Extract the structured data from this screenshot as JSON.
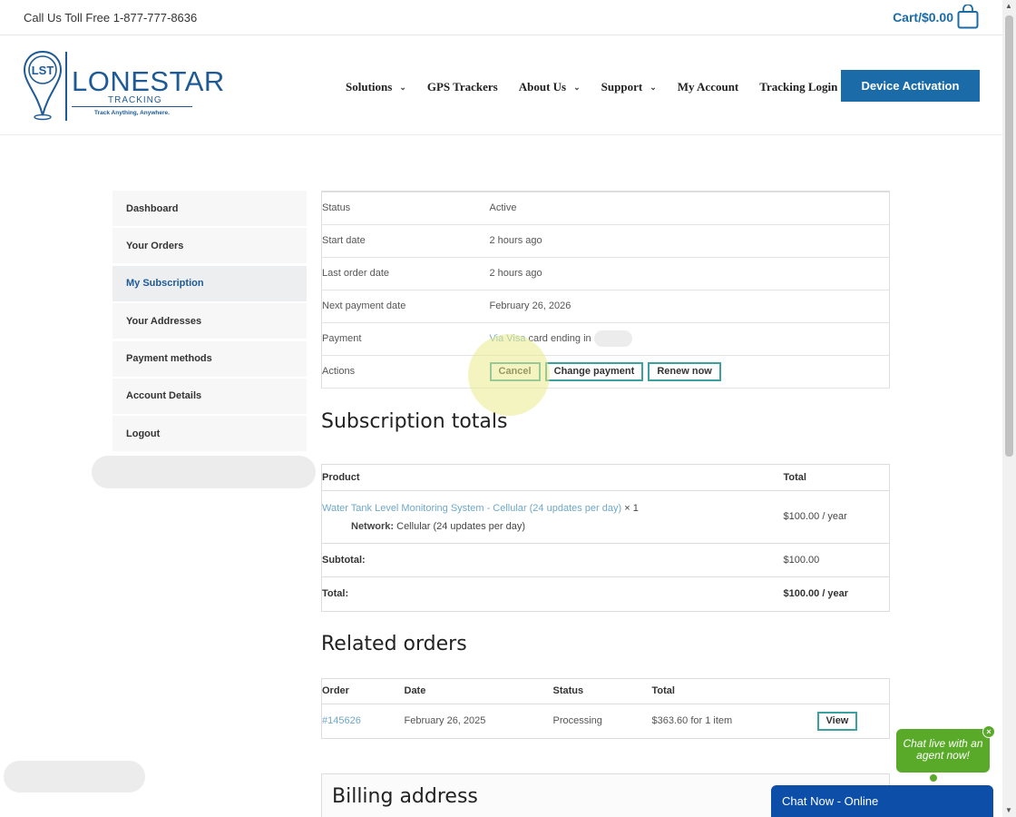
{
  "topbar": {
    "phone": "Call Us Toll Free 1-877-777-8636",
    "cart": "Cart/$0.00"
  },
  "logo": {
    "initials": "LST",
    "name": "LONESTAR",
    "sub": "TRACKING",
    "tagline": "Track Anything, Anywhere."
  },
  "nav": {
    "items": [
      {
        "label": "Solutions",
        "has_menu": true
      },
      {
        "label": "GPS Trackers",
        "has_menu": false
      },
      {
        "label": "About Us",
        "has_menu": true
      },
      {
        "label": "Support",
        "has_menu": true
      },
      {
        "label": "My Account",
        "has_menu": false
      },
      {
        "label": "Tracking Login",
        "has_menu": false
      }
    ],
    "cta": "Device Activation"
  },
  "sidebar": {
    "items": [
      {
        "label": "Dashboard"
      },
      {
        "label": "Your Orders"
      },
      {
        "label": "My Subscription"
      },
      {
        "label": "Your Addresses"
      },
      {
        "label": "Payment methods"
      },
      {
        "label": "Account Details"
      },
      {
        "label": "Logout"
      }
    ],
    "active_index": 2
  },
  "subscription": {
    "status_label": "Status",
    "status_value": "Active",
    "start_label": "Start date",
    "start_value": "2 hours ago",
    "last_order_label": "Last order date",
    "last_order_value": "2 hours ago",
    "next_payment_label": "Next payment date",
    "next_payment_value": "February 26, 2026",
    "payment_label": "Payment",
    "payment_link": "Via Visa",
    "payment_rest": "card ending in",
    "actions_label": "Actions",
    "cancel": "Cancel",
    "change_payment": "Change payment",
    "renew_now": "Renew now"
  },
  "totals": {
    "heading": "Subscription totals",
    "col_product": "Product",
    "col_total": "Total",
    "product_name": "Water Tank Level Monitoring System - Cellular (24 updates per day)",
    "product_qty": "× 1",
    "meta_key": "Network:",
    "meta_value": "Cellular (24 updates per day)",
    "product_total": "$100.00 / year",
    "subtotal_label": "Subtotal:",
    "subtotal_value": "$100.00",
    "total_label": "Total:",
    "total_value": "$100.00 / year"
  },
  "related": {
    "heading": "Related orders",
    "col_order": "Order",
    "col_date": "Date",
    "col_status": "Status",
    "col_total": "Total",
    "order_number": "#145626",
    "order_date": "February 26, 2025",
    "order_status": "Processing",
    "order_total": "$363.60 for 1 item",
    "view": "View"
  },
  "billing": {
    "heading": "Billing address"
  },
  "chat": {
    "bubble": "Chat live with an agent now!",
    "close": "×",
    "bar": "Chat Now - Online"
  },
  "colors": {
    "brand_blue": "#1a6ba8",
    "chat_green": "#5aaa2a",
    "chat_blue": "#0d4fa8",
    "button_border": "#3aa0a0"
  }
}
